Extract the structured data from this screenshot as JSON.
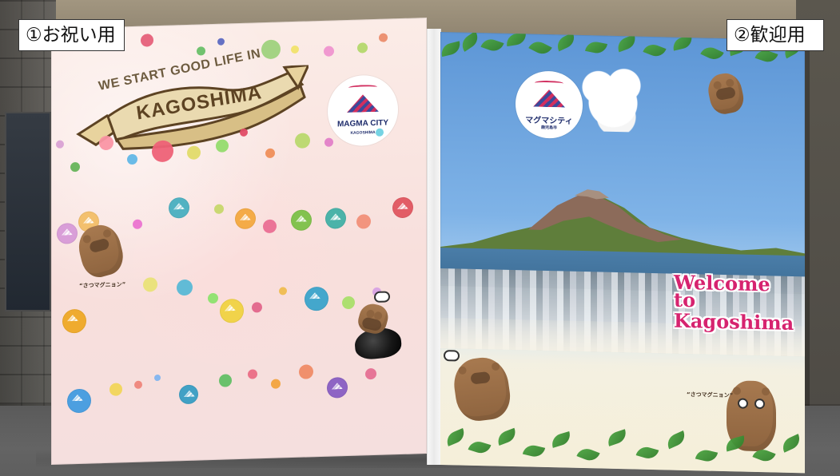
{
  "labels": {
    "left": "①お祝い用",
    "right": "②歓迎用"
  },
  "left_panel": {
    "banner_top": "WE START GOOD LIFE IN",
    "banner_main": "KAGOSHIMA",
    "logo_main": "MAGMA CITY",
    "logo_sub": "KAGOSHIMA",
    "caption": "“さつマグニョン”"
  },
  "right_panel": {
    "logo_main": "マグマシティ",
    "logo_sub": "鹿児島市",
    "welcome_line1": "Welcome to",
    "welcome_line2": "Kagoshima",
    "caption": "“さつマグニョン”"
  },
  "colors": {
    "accent_pink": "#d6236f",
    "logo_blue": "#1f2d6c",
    "logo_red": "#d12e5f",
    "leaf_green": "#3d9338"
  }
}
